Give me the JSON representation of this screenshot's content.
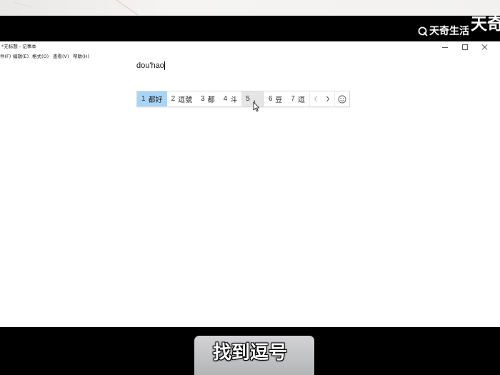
{
  "watermark": {
    "brand_text": "天奇生活",
    "corner_text": "天奇",
    "logo_icon": "brand-logo-icon"
  },
  "notepad": {
    "title": "*无标题 - 记事本",
    "controls": {
      "minimize_icon": "minimize-icon",
      "maximize_icon": "maximize-icon",
      "close_icon": "close-icon"
    },
    "menu": [
      "件(F)",
      "编辑(E)",
      "格式(O)",
      "查看(V)",
      "帮助(H)"
    ],
    "composition_text": "dou'hao"
  },
  "ime": {
    "candidates": [
      {
        "index": "1",
        "text": "都好"
      },
      {
        "index": "2",
        "text": "逗號"
      },
      {
        "index": "3",
        "text": "都"
      },
      {
        "index": "4",
        "text": "斗"
      },
      {
        "index": "5",
        "text": "，"
      },
      {
        "index": "6",
        "text": "豆"
      },
      {
        "index": "7",
        "text": "逗"
      }
    ],
    "selected_index": 1,
    "hovered_index": 5,
    "prev_icon": "chevron-left-icon",
    "next_icon": "chevron-right-icon",
    "emoji_icon": "smiley-icon"
  },
  "subtitle": "找到逗号",
  "colors": {
    "letterbox": "#000000",
    "selected_candidate": "#a8d4f7",
    "hovered_candidate": "#e5e5e5",
    "subtitle_text": "#ffffff"
  }
}
